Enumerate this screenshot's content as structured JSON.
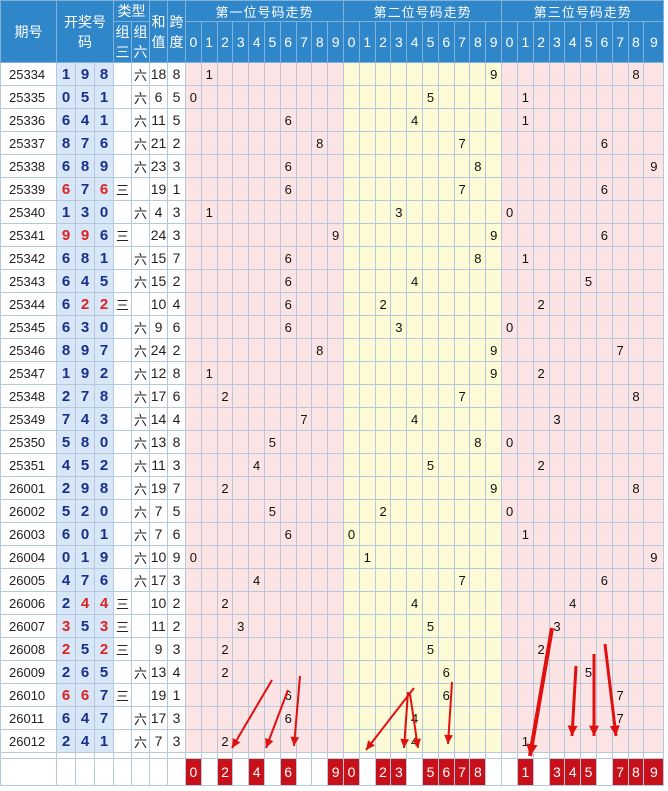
{
  "header": {
    "period": "期号",
    "draw": "开奖号码",
    "type": "类型",
    "type_g3": "组三",
    "type_g6": "组六",
    "sum": "和值",
    "span": "跨度",
    "section1": "第一位号码走势",
    "section2": "第二位号码走势",
    "section3": "第三位号码走势",
    "digits": [
      "0",
      "1",
      "2",
      "3",
      "4",
      "5",
      "6",
      "7",
      "8",
      "9"
    ]
  },
  "rows": [
    {
      "period": "25334",
      "draw": [
        "1",
        "9",
        "8"
      ],
      "type": "六",
      "sum": "18",
      "span": "8"
    },
    {
      "period": "25335",
      "draw": [
        "0",
        "5",
        "1"
      ],
      "type": "六",
      "sum": "6",
      "span": "5"
    },
    {
      "period": "25336",
      "draw": [
        "6",
        "4",
        "1"
      ],
      "type": "六",
      "sum": "11",
      "span": "5"
    },
    {
      "period": "25337",
      "draw": [
        "8",
        "7",
        "6"
      ],
      "type": "六",
      "sum": "21",
      "span": "2"
    },
    {
      "period": "25338",
      "draw": [
        "6",
        "8",
        "9"
      ],
      "type": "六",
      "sum": "23",
      "span": "3"
    },
    {
      "period": "25339",
      "draw": [
        "6",
        "7",
        "6"
      ],
      "type": "三",
      "sum": "19",
      "span": "1"
    },
    {
      "period": "25340",
      "draw": [
        "1",
        "3",
        "0"
      ],
      "type": "六",
      "sum": "4",
      "span": "3"
    },
    {
      "period": "25341",
      "draw": [
        "9",
        "9",
        "6"
      ],
      "type": "三",
      "sum": "24",
      "span": "3"
    },
    {
      "period": "25342",
      "draw": [
        "6",
        "8",
        "1"
      ],
      "type": "六",
      "sum": "15",
      "span": "7"
    },
    {
      "period": "25343",
      "draw": [
        "6",
        "4",
        "5"
      ],
      "type": "六",
      "sum": "15",
      "span": "2"
    },
    {
      "period": "25344",
      "draw": [
        "6",
        "2",
        "2"
      ],
      "type": "三",
      "sum": "10",
      "span": "4"
    },
    {
      "period": "25345",
      "draw": [
        "6",
        "3",
        "0"
      ],
      "type": "六",
      "sum": "9",
      "span": "6"
    },
    {
      "period": "25346",
      "draw": [
        "8",
        "9",
        "7"
      ],
      "type": "六",
      "sum": "24",
      "span": "2"
    },
    {
      "period": "25347",
      "draw": [
        "1",
        "9",
        "2"
      ],
      "type": "六",
      "sum": "12",
      "span": "8"
    },
    {
      "period": "25348",
      "draw": [
        "2",
        "7",
        "8"
      ],
      "type": "六",
      "sum": "17",
      "span": "6"
    },
    {
      "period": "25349",
      "draw": [
        "7",
        "4",
        "3"
      ],
      "type": "六",
      "sum": "14",
      "span": "4"
    },
    {
      "period": "25350",
      "draw": [
        "5",
        "8",
        "0"
      ],
      "type": "六",
      "sum": "13",
      "span": "8"
    },
    {
      "period": "25351",
      "draw": [
        "4",
        "5",
        "2"
      ],
      "type": "六",
      "sum": "11",
      "span": "3"
    },
    {
      "period": "26001",
      "draw": [
        "2",
        "9",
        "8"
      ],
      "type": "六",
      "sum": "19",
      "span": "7"
    },
    {
      "period": "26002",
      "draw": [
        "5",
        "2",
        "0"
      ],
      "type": "六",
      "sum": "7",
      "span": "5"
    },
    {
      "period": "26003",
      "draw": [
        "6",
        "0",
        "1"
      ],
      "type": "六",
      "sum": "7",
      "span": "6"
    },
    {
      "period": "26004",
      "draw": [
        "0",
        "1",
        "9"
      ],
      "type": "六",
      "sum": "10",
      "span": "9"
    },
    {
      "period": "26005",
      "draw": [
        "4",
        "7",
        "6"
      ],
      "type": "六",
      "sum": "17",
      "span": "3"
    },
    {
      "period": "26006",
      "draw": [
        "2",
        "4",
        "4"
      ],
      "type": "三",
      "sum": "10",
      "span": "2"
    },
    {
      "period": "26007",
      "draw": [
        "3",
        "5",
        "3"
      ],
      "type": "三",
      "sum": "11",
      "span": "2"
    },
    {
      "period": "26008",
      "draw": [
        "2",
        "5",
        "2"
      ],
      "type": "三",
      "sum": "9",
      "span": "3"
    },
    {
      "period": "26009",
      "draw": [
        "2",
        "6",
        "5"
      ],
      "type": "六",
      "sum": "13",
      "span": "4"
    },
    {
      "period": "26010",
      "draw": [
        "6",
        "6",
        "7"
      ],
      "type": "三",
      "sum": "19",
      "span": "1"
    },
    {
      "period": "26011",
      "draw": [
        "6",
        "4",
        "7"
      ],
      "type": "六",
      "sum": "17",
      "span": "3"
    },
    {
      "period": "26012",
      "draw": [
        "2",
        "4",
        "1"
      ],
      "type": "六",
      "sum": "7",
      "span": "3"
    }
  ],
  "summary": {
    "pos1": [
      "0",
      "",
      "2",
      "",
      "4",
      "",
      "6",
      "",
      "",
      "9"
    ],
    "pos2": [
      "0",
      "",
      "2",
      "3",
      "",
      "5",
      "6",
      "7",
      "8",
      ""
    ],
    "pos3": [
      "",
      "1",
      "",
      "3",
      "4",
      "5",
      "",
      "7",
      "8",
      "9"
    ]
  },
  "colors": {
    "header_bg": "#2f86c9",
    "draw_bg": "#d7e7f7",
    "section1_bg": "#fde4e4",
    "section2_bg": "#fdfad6",
    "section3_bg": "#fde4e4",
    "mark_bg": "#c8101a",
    "arrow": "#e01010"
  }
}
